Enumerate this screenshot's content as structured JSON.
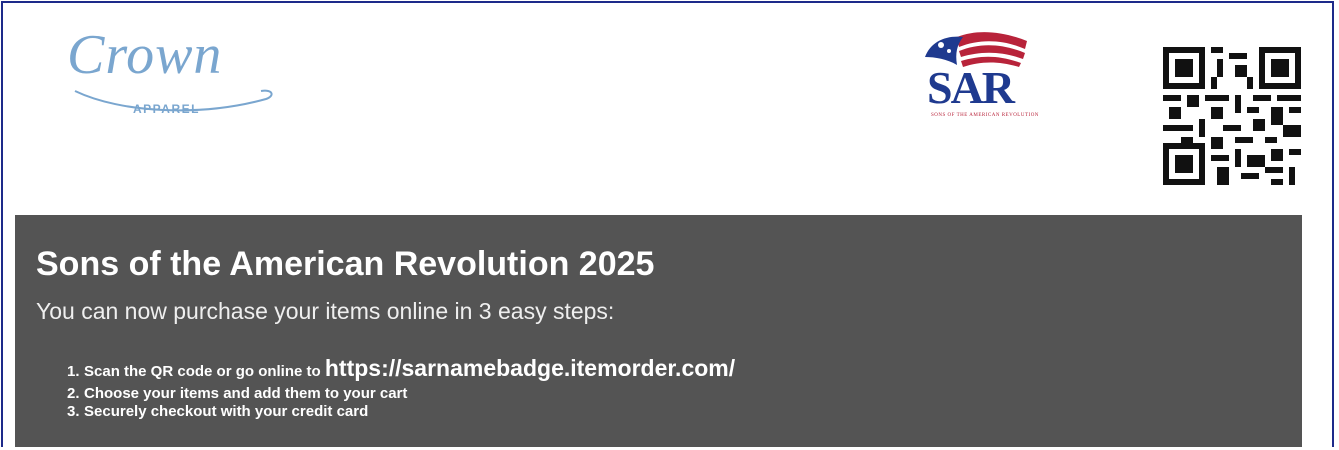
{
  "logos": {
    "crown": {
      "word": "Crown",
      "sub": "APPAREL",
      "color": "#7aa6cf"
    },
    "sar": {
      "text": "SAR",
      "motto": "SONS OF THE AMERICAN REVOLUTION",
      "blue": "#1f3a8f",
      "red": "#b8233a"
    },
    "qr": {
      "icon": "qr-code-icon"
    }
  },
  "banner": {
    "background": "#545454",
    "title": "Sons of the American Revolution 2025",
    "intro": "You can now purchase your items online in 3 easy steps:",
    "steps": [
      {
        "num": "1.",
        "text": "Scan the QR code or go online to ",
        "url": "https://sarnamebadge.itemorder.com/"
      },
      {
        "num": "2.",
        "text": "Choose your items and add them to your cart"
      },
      {
        "num": "3.",
        "text": "Securely checkout with your credit card"
      }
    ]
  }
}
